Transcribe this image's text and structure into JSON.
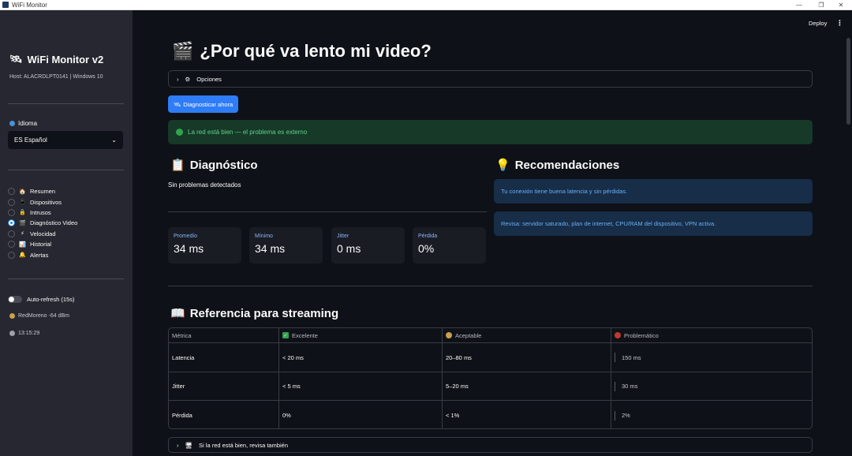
{
  "window": {
    "title": "WiFi Monitor",
    "minimize": "—",
    "restore": "❐",
    "close": "✕"
  },
  "header": {
    "deploy_label": "Deploy",
    "menu_icon": "⋮"
  },
  "sidebar": {
    "title": "WiFi Monitor v2",
    "title_icon": "🛰",
    "host": "Host: ALACRDLPT0141 | Windows 10",
    "language_label": "Idioma",
    "language_value": "🇪🇸 Español",
    "language_value_display": "ES Español",
    "nav_items": [
      {
        "label": "Resumen",
        "icon": "🏠",
        "selected": false
      },
      {
        "label": "Dispositivos",
        "icon": "📱",
        "selected": false
      },
      {
        "label": "Intrusos",
        "icon": "🔒",
        "selected": false
      },
      {
        "label": "Diagnóstico Video",
        "icon": "🎬",
        "selected": true
      },
      {
        "label": "Velocidad",
        "icon": "⚡",
        "selected": false
      },
      {
        "label": "Historial",
        "icon": "📊",
        "selected": false
      },
      {
        "label": "Alertas",
        "icon": "🔔",
        "selected": false
      }
    ],
    "autorefresh_label": "Auto-refresh (15s)",
    "network": "RedMoreno -64 dBm",
    "time": "13:15:29"
  },
  "main": {
    "title": "¿Por qué va lento mi video?",
    "title_icon": "🎬",
    "options_label": "Opciones",
    "diagnose_button": "Diagnosticar ahora",
    "status_message": "La red está bien — el problema es externo",
    "diagnosis": {
      "heading": "Diagnóstico",
      "text": "Sin problemas detectados",
      "metrics": [
        {
          "label": "Promedio",
          "value": "34 ms"
        },
        {
          "label": "Mínimo",
          "value": "34 ms"
        },
        {
          "label": "Jitter",
          "value": "0 ms"
        },
        {
          "label": "Pérdida",
          "value": "0%"
        }
      ]
    },
    "recommendations": {
      "heading": "Recomendaciones",
      "items": [
        "Tu conexión tiene buena latencia y sin pérdidas.",
        "Revisa: servidor saturado, plan de internet, CPU/RAM del dispositivo, VPN activa."
      ]
    },
    "reference": {
      "heading": "Referencia para streaming",
      "columns": [
        "Métrica",
        "Excelente",
        "Aceptable",
        "Problemático"
      ],
      "rows": [
        [
          "Latencia",
          "< 20 ms",
          "20–80 ms",
          "150 ms"
        ],
        [
          "Jitter",
          "< 5 ms",
          "5–20 ms",
          "30 ms"
        ],
        [
          "Pérdida",
          "0%",
          "< 1%",
          "2%"
        ]
      ]
    },
    "also_check_label": "Si la red está bien, revisa también"
  },
  "colors": {
    "accent": "#2e7cf6",
    "success": "#5fd38d",
    "info": "#6ab0f3",
    "sidebar": "#262730",
    "background": "#0e1117"
  }
}
